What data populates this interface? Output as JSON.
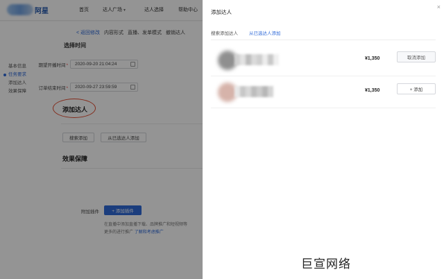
{
  "topnav": {
    "logo_text": "阿星",
    "items": [
      {
        "label": "首页"
      },
      {
        "label": "达人广场",
        "caret": true
      },
      {
        "label": "达人选择"
      },
      {
        "label": "帮助中心"
      }
    ]
  },
  "card": {
    "back_link": "< 返回修改",
    "tabs": [
      "内容形式",
      "直播、发单模式",
      "撤销达人"
    ],
    "partial_section": "选择时间",
    "sidebar": [
      "基本信息",
      "任务要求",
      "添加达人",
      "效果保障"
    ],
    "active_sidebar_index": 1,
    "fields": [
      {
        "label": "期望开播时间",
        "value": "2020-09-20 21:04:24"
      },
      {
        "label": "订单结束时间",
        "value": "2020-09-27 23:59:59"
      }
    ],
    "add_kol_section": "添加达人",
    "search_add_button": "搜索添加",
    "from_selected_button": "从已选达人添加",
    "guarantee_section": "效果保障",
    "attach_label": "附加插件",
    "attach_button": "+ 添加插件",
    "help_line_1": "在直播中添加直播下载、品牌推广和短视频等",
    "help_line_2_prefix": "更多的进行推广",
    "help_line_2_link": "了解和考虑推广"
  },
  "drawer": {
    "title": "添加达人",
    "close_icon": "close-icon",
    "tabs": [
      {
        "label": "搜索添加达人",
        "active": false
      },
      {
        "label": "从已选达人添加",
        "active": true
      }
    ],
    "rows": [
      {
        "price": "¥1,350",
        "button": "取消添加",
        "avatar_color": "#8f8f8f",
        "name_colors": [
          "#d0d0d0",
          "#e3e3e3",
          "#bcbcbc",
          "#dadada",
          "#cfcfcf",
          "#ececec",
          "#c8c8c8",
          "#f0f0f0"
        ]
      },
      {
        "price": "¥1,350",
        "button": "+ 添加",
        "avatar_color": "#d6b3aa",
        "name_colors": [
          "#e7e7e7",
          "#c7c7c7",
          "#d8d8d8",
          "#bdbdbd",
          "#cccccc",
          "#b7b7b7",
          "#d3d3d3"
        ]
      }
    ]
  },
  "watermark": "巨宣网络"
}
